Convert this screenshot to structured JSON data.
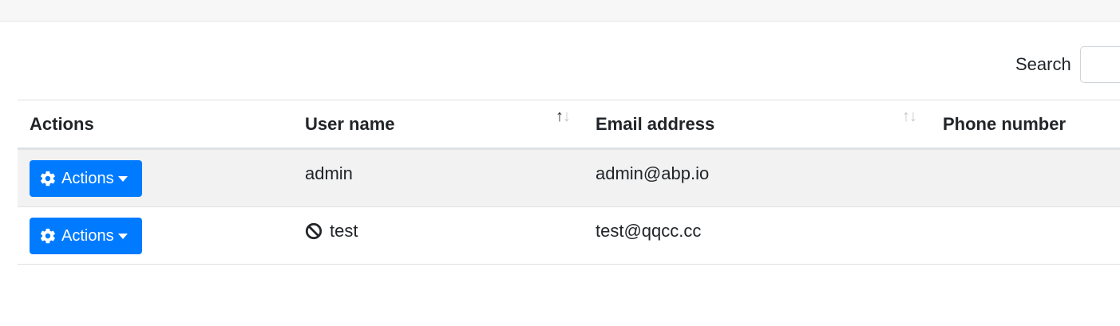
{
  "search": {
    "label": "Search",
    "value": ""
  },
  "table": {
    "columns": [
      {
        "label": "Actions",
        "sortable": false
      },
      {
        "label": "User name",
        "sortable": true,
        "sort": "asc"
      },
      {
        "label": "Email address",
        "sortable": true,
        "sort": "none"
      },
      {
        "label": "Phone number",
        "sortable": false
      }
    ],
    "rows": [
      {
        "action_label": "Actions",
        "user_name": "admin",
        "email": "admin@abp.io",
        "phone": "",
        "locked": false
      },
      {
        "action_label": "Actions",
        "user_name": "test",
        "email": "test@qqcc.cc",
        "phone": "",
        "locked": true
      }
    ]
  },
  "icons": {
    "action": "gear-icon",
    "locked": "ban-icon"
  },
  "colors": {
    "primary": "#007bff",
    "stripe": "#f2f2f2"
  }
}
